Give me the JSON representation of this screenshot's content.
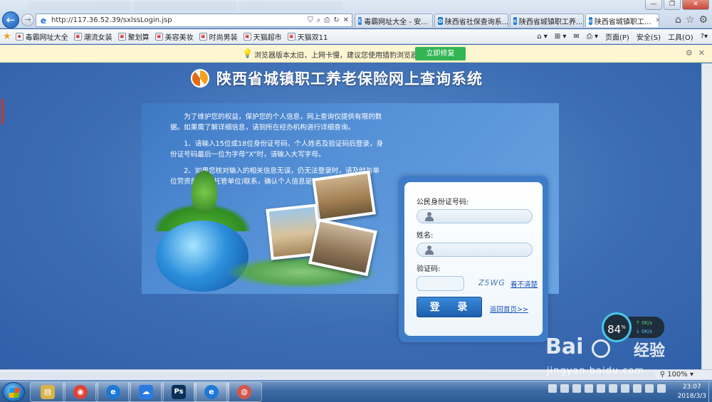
{
  "browser": {
    "address_url": "http://117.36.52.39/sxlssLogin.jsp",
    "tabs": [
      {
        "label": "毒霸网址大全 - 安...",
        "fav_color": "#2f7ad4",
        "fav_glyph": "K",
        "active": false
      },
      {
        "label": "陕西省社保查询系...",
        "fav_color": "#1a73c9",
        "fav_glyph": "✿",
        "active": false
      },
      {
        "label": "陕西省城镇职工养...",
        "fav_color": "#1e78d6",
        "fav_glyph": "e",
        "active": false
      },
      {
        "label": "陕西省城镇职工...",
        "fav_color": "#1e78d6",
        "fav_glyph": "e",
        "active": true
      }
    ],
    "favorites": [
      "毒霸网址大全",
      "潮流女装",
      "聚划算",
      "美容美妆",
      "时尚男装",
      "天猫超市",
      "天猫双11"
    ],
    "command_bar": {
      "page_menu": "页面(P)",
      "safety_menu": "安全(S)",
      "tools_menu": "工具(O)"
    },
    "notice": {
      "text": "浏览器版本太旧，上网卡慢，建议您使用猎豹浏览器修复",
      "button": "立即修复"
    }
  },
  "page": {
    "system_title": "陕西省城镇职工养老保险网上查询系统",
    "intro_paragraphs": [
      "为了维护您的权益，保护您的个人信息，网上查询仅提供有限的数据。如果需了解详细信息，请到所在经办机构进行详细查询。",
      "1、请输入15位或18位身份证号码、个人姓名及验证码后登录，身份证号码最后一位为字母“X”时，请输入大写字母。",
      "2、如果您核对输入的相关信息无误，仍无法登录时，请及时与单位劳资部门(或托管单位)联系，确认个人信息是否正确。"
    ],
    "login": {
      "id_label": "公民身份证号码:",
      "name_label": "姓名:",
      "captcha_label": "验证码:",
      "captcha_code": "Z5WG",
      "captcha_refresh": "看不清楚",
      "login_button": "登 录",
      "home_link": "返回首页>>"
    }
  },
  "speed_widget": {
    "percent": "84",
    "percent_sign": "%",
    "up": "0K/s",
    "down": "0K/s"
  },
  "statusbar": {
    "zoom": "100%"
  },
  "taskbar": {
    "clock_time": "23:07",
    "clock_date": "2018/3/3",
    "apps": [
      {
        "name": "explorer",
        "glyph": "▤",
        "color": "#d8b34a"
      },
      {
        "name": "chrome",
        "glyph": "◉",
        "color": "#db4437"
      },
      {
        "name": "ie",
        "glyph": "e",
        "color": "#1e78d6"
      },
      {
        "name": "baidu-netdisk",
        "glyph": "☁",
        "color": "#2a7ae2"
      },
      {
        "name": "photoshop",
        "glyph": "Ps",
        "color": "#0b3158"
      },
      {
        "name": "ie-active",
        "glyph": "e",
        "color": "#1e78d6"
      },
      {
        "name": "app-red",
        "glyph": "◍",
        "color": "#d4554a"
      }
    ]
  },
  "watermark": {
    "brand": "Bai",
    "product": "经验",
    "url": "jingyan.baidu.com"
  }
}
